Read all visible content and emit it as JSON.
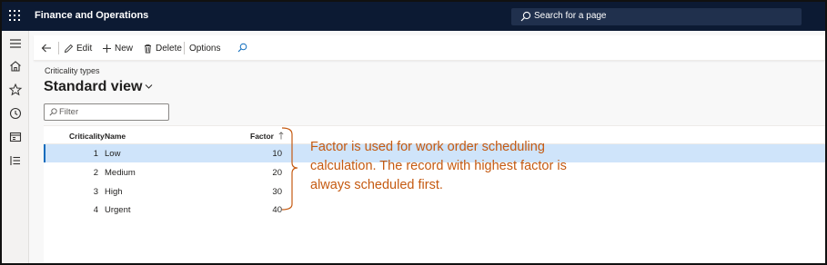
{
  "app": {
    "title": "Finance and Operations",
    "search_placeholder": "Search for a page"
  },
  "actionpane": {
    "edit": "Edit",
    "new": "New",
    "delete": "Delete",
    "options": "Options"
  },
  "page": {
    "breadcrumb": "Criticality types",
    "view_title": "Standard view",
    "filter_placeholder": "Filter"
  },
  "grid": {
    "columns": {
      "criticality": "Criticality",
      "name": "Name",
      "factor": "Factor"
    },
    "rows": [
      {
        "criticality": "1",
        "name": "Low",
        "factor": "10",
        "selected": true
      },
      {
        "criticality": "2",
        "name": "Medium",
        "factor": "20",
        "selected": false
      },
      {
        "criticality": "3",
        "name": "High",
        "factor": "30",
        "selected": false
      },
      {
        "criticality": "4",
        "name": "Urgent",
        "factor": "40",
        "selected": false
      }
    ]
  },
  "annotation": {
    "text": "Factor is used for work order scheduling calculation. The record with highest factor is always scheduled first.",
    "color": "#c55a11"
  },
  "colors": {
    "topbar": "#0c1a33",
    "selection": "#cfe4fa",
    "accent": "#0f6cbd"
  }
}
